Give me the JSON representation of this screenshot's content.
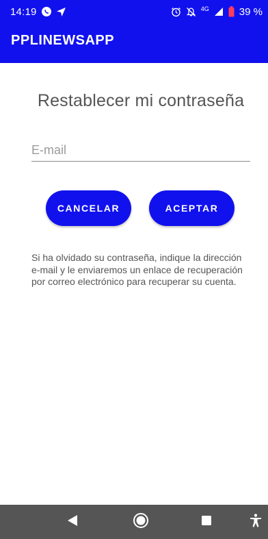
{
  "status_bar": {
    "time": "14:19",
    "network": "4G",
    "battery": "39 %",
    "icons": [
      "whatsapp-icon",
      "location-arrow-icon",
      "alarm-icon",
      "mute-icon",
      "signal-icon",
      "battery-icon"
    ]
  },
  "app_bar": {
    "title": "PPLINEWSAPP"
  },
  "main": {
    "title": "Restablecer mi contraseña",
    "email": {
      "placeholder": "E-mail",
      "value": ""
    },
    "cancel_label": "CANCELAR",
    "accept_label": "ACEPTAR",
    "help_text": "Si ha olvidado su contraseña, indique la dirección e-mail y le enviaremos un enlace de recuperación por correo electrónico para recuperar su cuenta."
  },
  "nav_bar": {
    "icons": [
      "back-icon",
      "home-icon",
      "recent-apps-icon",
      "accessibility-icon"
    ]
  },
  "colors": {
    "primary": "#1111ee",
    "nav_bar": "#555555",
    "text_secondary": "#555555"
  }
}
